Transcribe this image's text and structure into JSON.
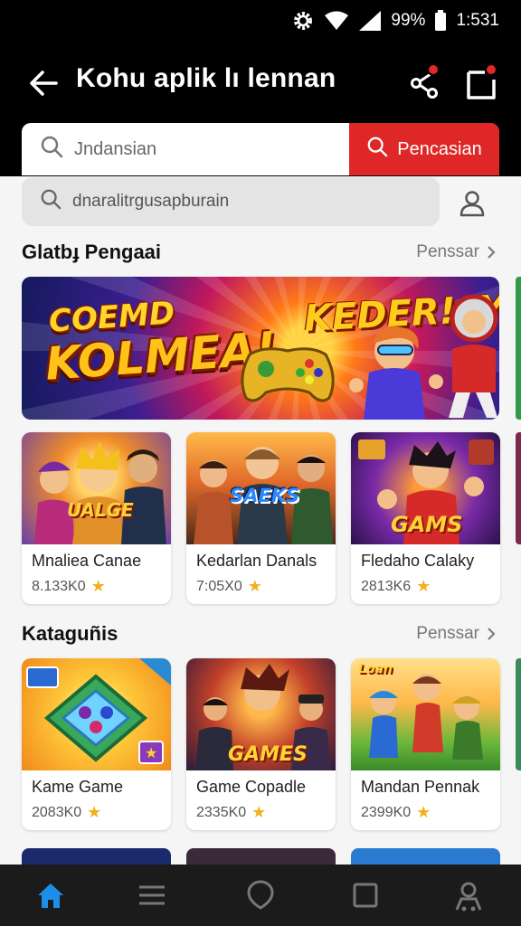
{
  "status": {
    "battery": "99%",
    "time": "1:531"
  },
  "header": {
    "title": "Kohu aplik lı lennan"
  },
  "search": {
    "placeholder": "Jndansian",
    "button_label": "Pencasian",
    "secondary_placeholder": "dnaralitrgusapburain"
  },
  "featured": {
    "title": "Glatbɟ Pengaai",
    "more_label": "Penssar",
    "banner": {
      "headline_top": "COEMD",
      "headline_main": "KOLMEA!",
      "headline_right": "KEDER!AY"
    },
    "cards": [
      {
        "name": "Mnaliea Canae",
        "rating": "8.133K0",
        "art_label": "UALGE"
      },
      {
        "name": "Kedarlan Danals",
        "rating": "7:05X0",
        "art_label": "SAEKS"
      },
      {
        "name": "Fledaho Calaky",
        "rating": "2813K6",
        "art_label": "GAMS"
      }
    ]
  },
  "categories": {
    "title": "Kataguñis",
    "more_label": "Penssar",
    "cards": [
      {
        "name": "Kame Game",
        "rating": "2083K0",
        "art_label": ""
      },
      {
        "name": "Game Copadle",
        "rating": "2335K0",
        "art_label": "GAMES"
      },
      {
        "name": "Mandan Pennak",
        "rating": "2399K0",
        "art_label": "Loan"
      }
    ]
  },
  "colors": {
    "accent": "#e02727",
    "star": "#f2b01e",
    "nav_active": "#1e8fe8"
  },
  "nav": [
    "home-icon",
    "menu-icon",
    "circle-icon",
    "square-icon",
    "profile-icon"
  ]
}
